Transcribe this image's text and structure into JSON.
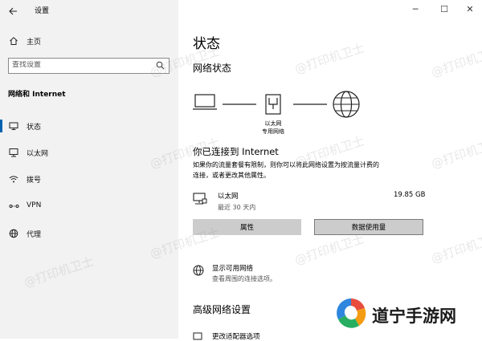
{
  "window": {
    "title": "设置",
    "back_icon": "back-arrow-icon",
    "minimize": "─",
    "maximize": "☐",
    "close": "✕"
  },
  "sidebar": {
    "home_label": "主页",
    "search_placeholder": "查找设置",
    "section_title": "网络和 Internet",
    "items": [
      {
        "label": "状态",
        "icon": "status-icon",
        "selected": true
      },
      {
        "label": "以太网",
        "icon": "ethernet-icon"
      },
      {
        "label": "拨号",
        "icon": "dialup-icon"
      },
      {
        "label": "VPN",
        "icon": "vpn-icon"
      },
      {
        "label": "代理",
        "icon": "proxy-icon"
      }
    ]
  },
  "main": {
    "title": "状态",
    "network_status_heading": "网络状态",
    "diagram": {
      "node_label_line1": "以太网",
      "node_label_line2": "专用网络"
    },
    "connected_title": "你已连接到 Internet",
    "connected_desc_line1": "如果你的流量套餐有限制，则你可以将此网络设置为按流量计费的",
    "connected_desc_line2": "连接，或者更改其他属性。",
    "adapter": {
      "name": "以太网",
      "period": "最近 30 天内",
      "usage": "19.85 GB"
    },
    "buttons": {
      "properties": "属性",
      "data_usage": "数据使用量"
    },
    "available": {
      "title": "显示可用网络",
      "desc": "查看周围的连接选项。"
    },
    "advanced_heading": "高级网络设置",
    "advanced_first_item": "更改适配器选项"
  },
  "watermark": {
    "text": "@打印机卫士",
    "brand": "道宁手游网"
  },
  "colors": {
    "sidebar_bg": "#f2f2f2",
    "accent": "#0063b1",
    "button_bg": "#cccccc"
  }
}
